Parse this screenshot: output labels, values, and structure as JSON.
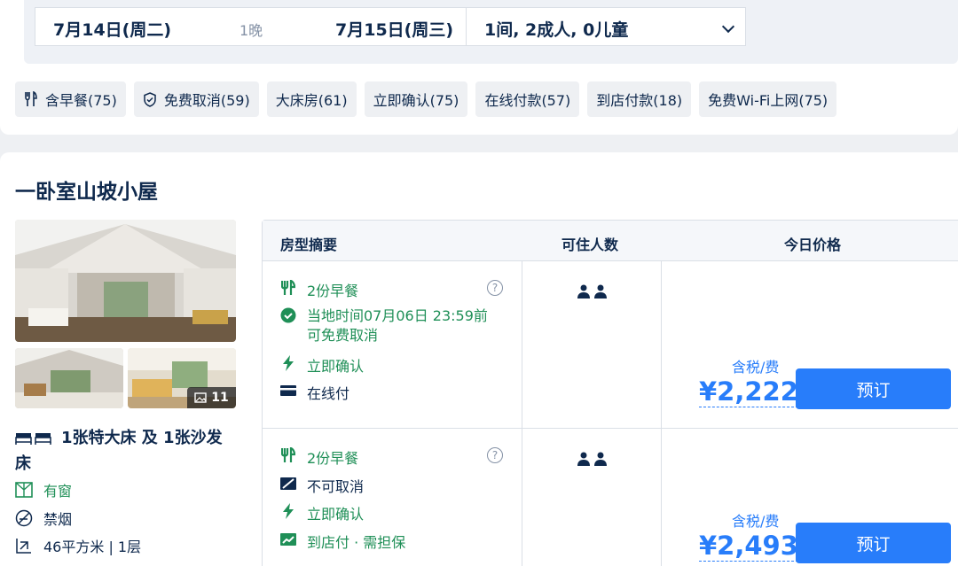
{
  "search": {
    "checkin": "7月14日(周二)",
    "nights": "1晚",
    "checkout": "7月15日(周三)",
    "guests": "1间, 2成人, 0儿童"
  },
  "filters": [
    {
      "label": "含早餐(75)",
      "icon": "utensils-icon"
    },
    {
      "label": "免费取消(59)",
      "icon": "shield-icon"
    },
    {
      "label": "大床房(61)"
    },
    {
      "label": "立即确认(75)"
    },
    {
      "label": "在线付款(57)"
    },
    {
      "label": "到店付款(18)"
    },
    {
      "label": "免费Wi-Fi上网(75)"
    }
  ],
  "room": {
    "title": "一卧室山坡小屋",
    "photo_count": "11",
    "bed": "1张特大床 及 1张沙发床",
    "features": [
      "有窗",
      "禁烟",
      "46平方米 | 1层"
    ]
  },
  "table": {
    "headers": [
      "房型摘要",
      "可住人数",
      "今日价格"
    ],
    "rows": [
      {
        "breakfast": "2份早餐",
        "cancel": "当地时间07月06日 23:59前可免费取消",
        "confirm": "立即确认",
        "payment": "在线付",
        "tax_label": "含税/费",
        "price": "¥2,222",
        "book_label": "预订"
      },
      {
        "breakfast": "2份早餐",
        "cancel": "不可取消",
        "confirm": "立即确认",
        "payment": "到店付 · 需担保",
        "tax_label": "含税/费",
        "price": "¥2,493",
        "book_label": "预订"
      }
    ]
  },
  "colors": {
    "accent": "#287dfa",
    "green": "#1f8f57",
    "text": "#0f294d"
  }
}
